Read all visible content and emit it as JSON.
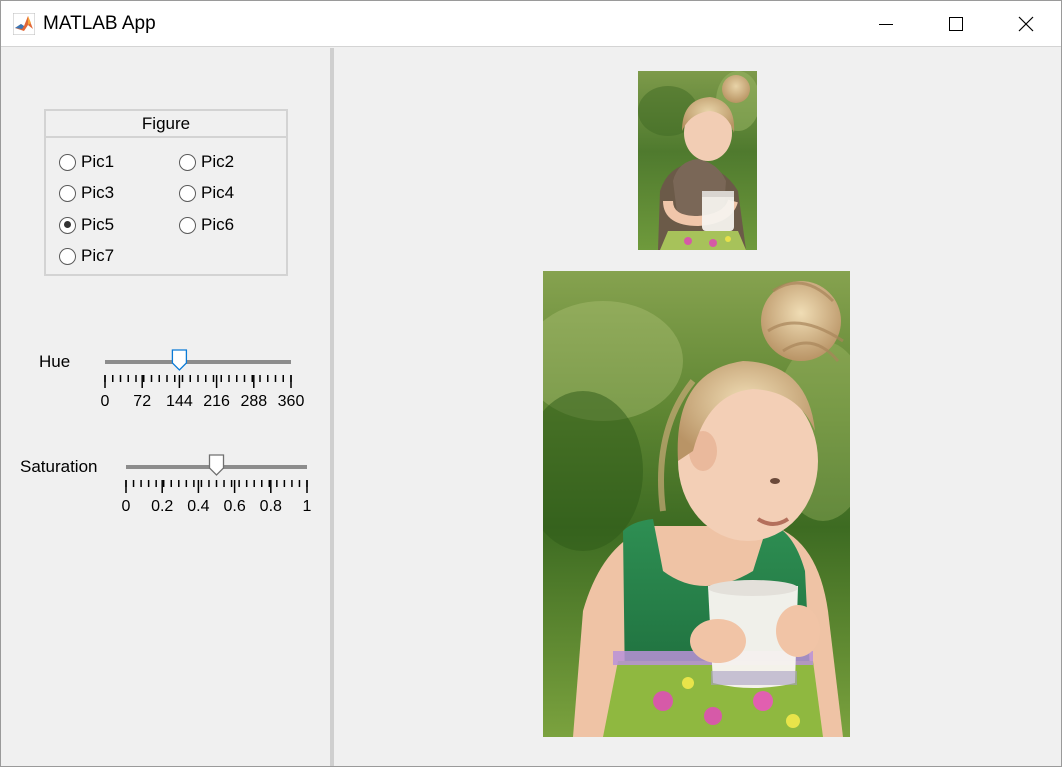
{
  "window": {
    "title": "MATLAB App",
    "controls": [
      "minimize",
      "maximize",
      "close"
    ]
  },
  "figure_group": {
    "title": "Figure",
    "options": [
      {
        "label": "Pic1",
        "selected": false
      },
      {
        "label": "Pic2",
        "selected": false
      },
      {
        "label": "Pic3",
        "selected": false
      },
      {
        "label": "Pic4",
        "selected": false
      },
      {
        "label": "Pic5",
        "selected": true
      },
      {
        "label": "Pic6",
        "selected": false
      },
      {
        "label": "Pic7",
        "selected": false
      }
    ]
  },
  "hue": {
    "label": "Hue",
    "min": 0,
    "max": 360,
    "value": 144,
    "ticks": [
      "0",
      "72",
      "144",
      "216",
      "288",
      "360"
    ],
    "focused": true
  },
  "saturation": {
    "label": "Saturation",
    "min": 0,
    "max": 1,
    "value": 0.5,
    "ticks": [
      "0",
      "0.2",
      "0.4",
      "0.6",
      "0.8",
      "1"
    ],
    "focused": false
  },
  "images": {
    "thumbnail": "girl-holding-milk-glass-small",
    "preview": "girl-holding-milk-glass-large"
  },
  "colors": {
    "accent": "#0a7ad6",
    "track": "#8c8c8c",
    "panel": "#f0f0f0"
  }
}
